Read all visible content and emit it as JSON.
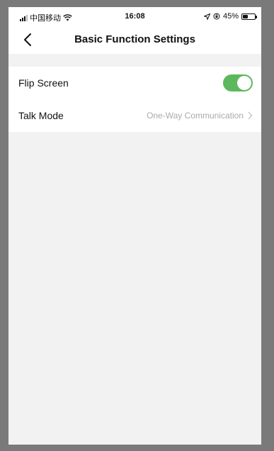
{
  "status_bar": {
    "carrier": "中国移动",
    "time": "16:08",
    "battery_percent": "45%",
    "battery_level": 0.45,
    "icons": [
      "signal-icon",
      "wifi-icon",
      "location-icon",
      "orientation-lock-icon",
      "battery-icon"
    ]
  },
  "nav": {
    "title": "Basic Function Settings",
    "back_icon": "chevron-left-icon"
  },
  "settings": {
    "flip_screen": {
      "label": "Flip Screen",
      "enabled": true,
      "toggle_color": "#5cb85c"
    },
    "talk_mode": {
      "label": "Talk Mode",
      "value": "One-Way Communication",
      "icon": "chevron-right-icon"
    }
  }
}
